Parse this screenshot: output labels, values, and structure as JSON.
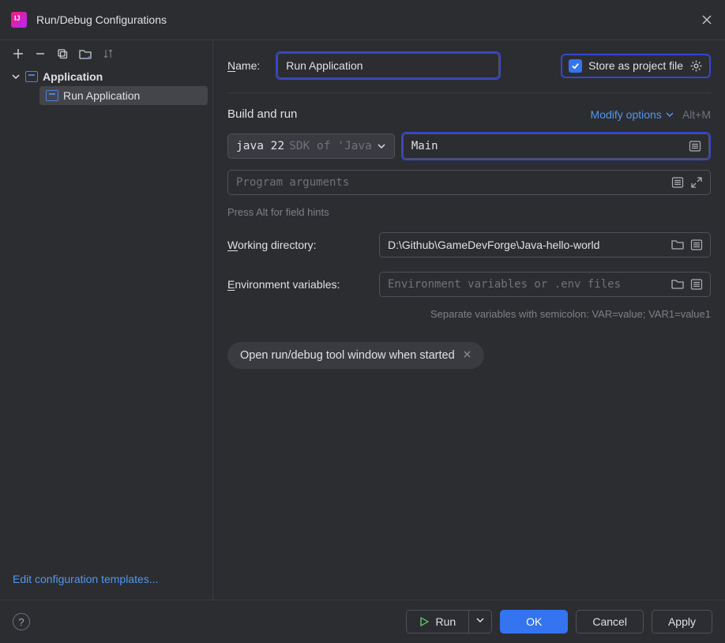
{
  "window": {
    "title": "Run/Debug Configurations"
  },
  "sidebar": {
    "tree": {
      "parent": "Application",
      "child": "Run Application"
    },
    "footer_link": "Edit configuration templates..."
  },
  "form": {
    "name_label": "Name:",
    "name_value": "Run Application",
    "store_label": "Store as project file",
    "store_checked": true,
    "section_title": "Build and run",
    "modify_options": "Modify options",
    "modify_shortcut": "Alt+M",
    "sdk_primary": "java 22",
    "sdk_secondary": "SDK of 'Java",
    "main_class": "Main",
    "program_args_placeholder": "Program arguments",
    "field_hint": "Press Alt for field hints",
    "working_dir_label": "Working directory:",
    "working_dir_value": "D:\\Github\\GameDevForge\\Java-hello-world",
    "env_label": "Environment variables:",
    "env_placeholder": "Environment variables or .env files",
    "env_hint": "Separate variables with semicolon: VAR=value; VAR1=value1",
    "chip_label": "Open run/debug tool window when started"
  },
  "footer": {
    "run": "Run",
    "ok": "OK",
    "cancel": "Cancel",
    "apply": "Apply"
  }
}
